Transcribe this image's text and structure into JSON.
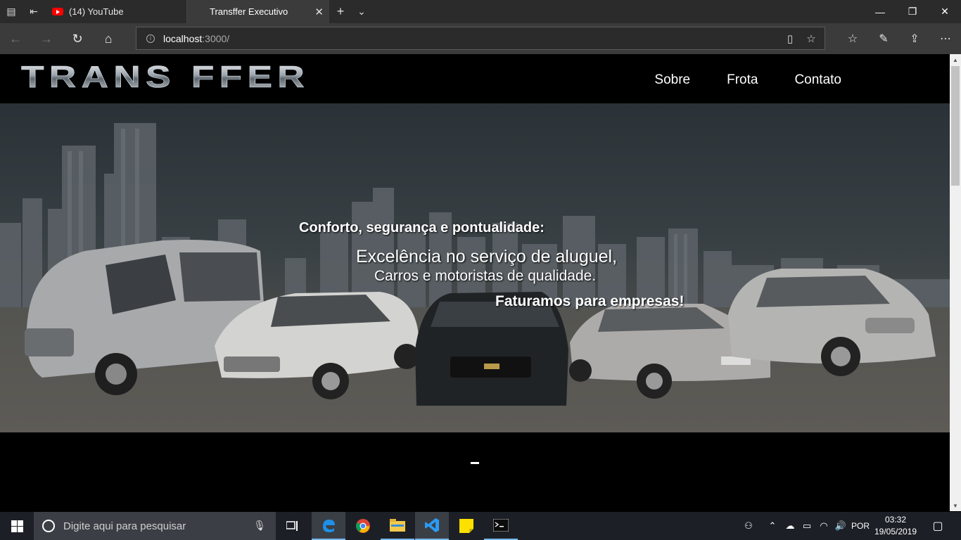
{
  "browser": {
    "tabs": [
      {
        "title": "(14) YouTube",
        "active": false
      },
      {
        "title": "Transffer Executivo",
        "active": true
      }
    ],
    "url_host": "localhost",
    "url_rest": ":3000/"
  },
  "site": {
    "logo_text": "TRANS FFER",
    "nav": [
      "Sobre",
      "Frota",
      "Contato"
    ],
    "hero": {
      "line1": "Conforto, segurança e pontualidade:",
      "line2": "Excelência no serviço de aluguel,",
      "line3": "Carros e motoristas de qualidade.",
      "line4": "Faturamos para empresas!"
    }
  },
  "taskbar": {
    "search_placeholder": "Digite aqui para pesquisar",
    "language": "POR",
    "time": "03:32",
    "date": "19/05/2019"
  },
  "colors": {
    "chrome_dark": "#2b2b2b",
    "chrome_mid": "#3b3b3b",
    "taskbar": "#1c2026",
    "accent": "#76b9ed"
  }
}
